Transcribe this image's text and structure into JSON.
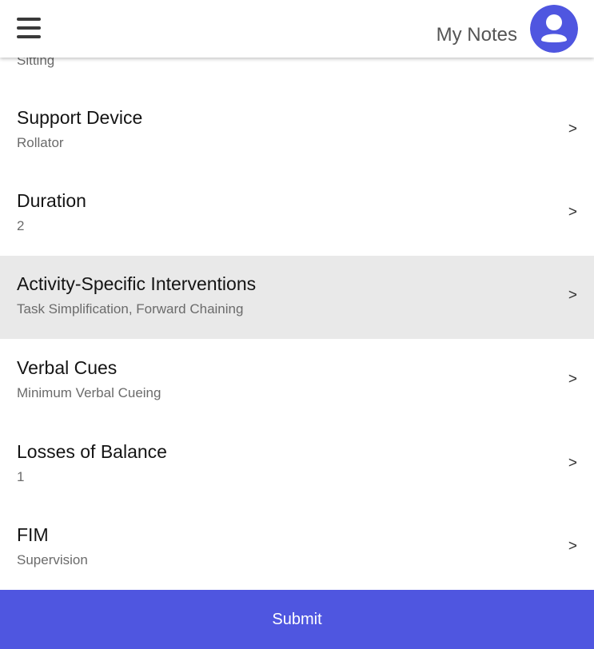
{
  "header": {
    "title": "My Notes",
    "menu_icon": "hamburger-menu-icon",
    "avatar_icon": "user-avatar-icon"
  },
  "list": {
    "partial_item": {
      "subtitle": "Sitting"
    },
    "items": [
      {
        "title": "Support Device",
        "value": "Rollator",
        "selected": false
      },
      {
        "title": "Duration",
        "value": "2",
        "selected": false
      },
      {
        "title": "Activity-Specific Interventions",
        "value": "Task Simplification, Forward Chaining",
        "selected": true
      },
      {
        "title": "Verbal Cues",
        "value": "Minimum Verbal Cueing",
        "selected": false
      },
      {
        "title": "Losses of Balance",
        "value": "1",
        "selected": false
      },
      {
        "title": "FIM",
        "value": "Supervision",
        "selected": false
      }
    ],
    "chevron": ">"
  },
  "footer": {
    "submit_label": "Submit"
  },
  "colors": {
    "accent": "#4f56e0",
    "selected_row": "#e9e9e9",
    "title_text": "#141414",
    "subtitle_text": "#6b6b6b"
  }
}
